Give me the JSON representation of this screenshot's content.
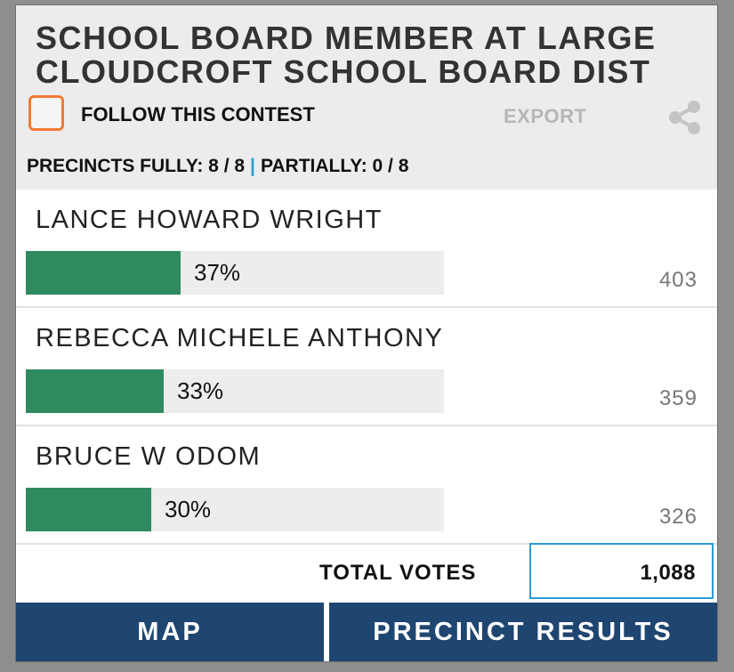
{
  "contest": {
    "title_line1": "SCHOOL BOARD MEMBER AT LARGE",
    "title_line2": "CLOUDCROFT SCHOOL BOARD DIST",
    "follow_label": "FOLLOW THIS CONTEST",
    "export_label": "EXPORT",
    "share_icon": "share-icon",
    "precincts_fully": "PRECINCTS FULLY: 8 / 8",
    "separator": "|",
    "precincts_partially": "PARTIALLY: 0 / 8"
  },
  "candidates": [
    {
      "name": "LANCE HOWARD WRIGHT",
      "percent_label": "37%",
      "percent": 37,
      "votes": "403"
    },
    {
      "name": "REBECCA MICHELE ANTHONY",
      "percent_label": "33%",
      "percent": 33,
      "votes": "359"
    },
    {
      "name": "BRUCE W ODOM",
      "percent_label": "30%",
      "percent": 30,
      "votes": "326"
    }
  ],
  "totals": {
    "label": "TOTAL VOTES",
    "value": "1,088"
  },
  "actions": {
    "map_label": "MAP",
    "precinct_results_label": "PRECINCT RESULTS"
  },
  "colors": {
    "bar_fill": "#2f8a60",
    "follow_checkbox_border": "#f07a32",
    "accent_blue": "#2b9bd6",
    "button_bg": "#1f4671"
  }
}
